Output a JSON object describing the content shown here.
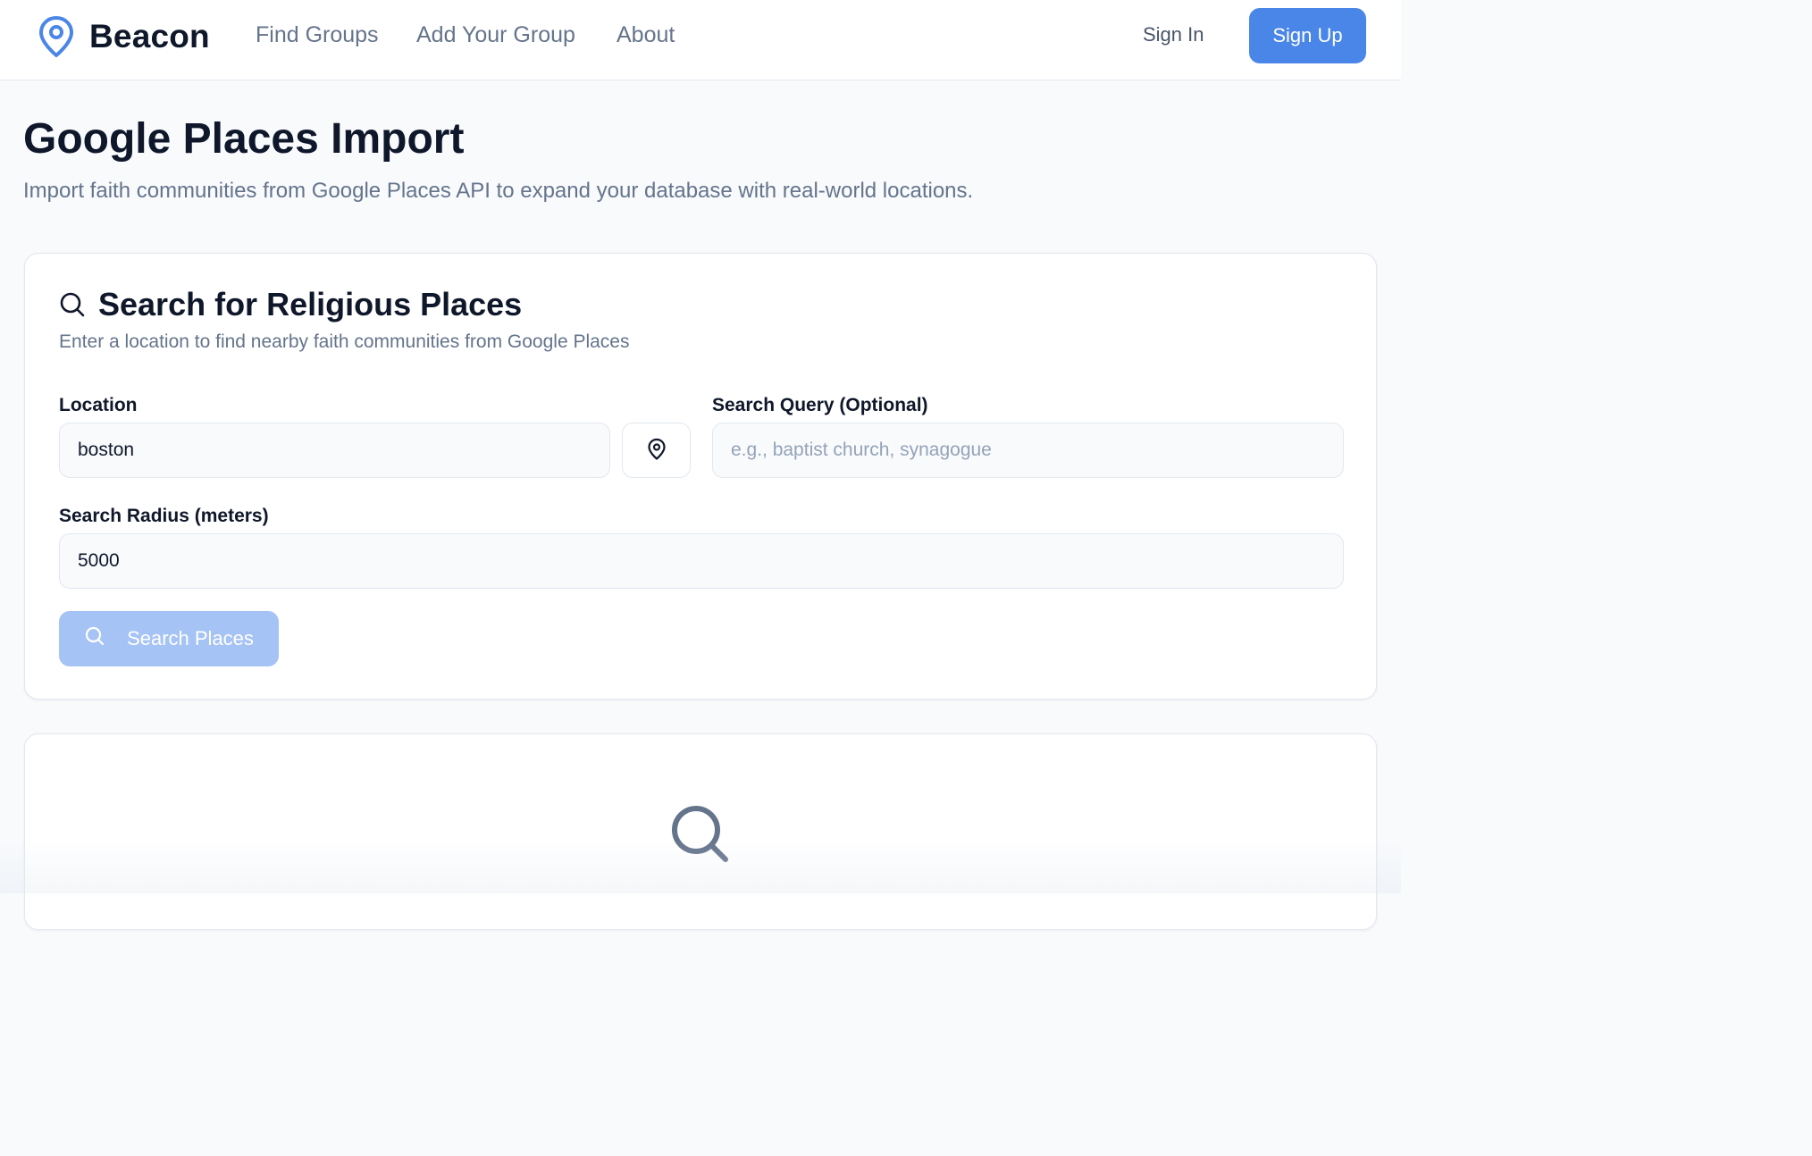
{
  "header": {
    "brand": "Beacon",
    "brand_icon": "map-pin-icon",
    "nav": {
      "find_groups": "Find Groups",
      "add_group": "Add Your Group",
      "about": "About"
    },
    "sign_in": "Sign In",
    "sign_up": "Sign Up"
  },
  "page": {
    "title": "Google Places Import",
    "subtitle": "Import faith communities from Google Places API to expand your database with real-world locations."
  },
  "search_card": {
    "icon": "search-icon",
    "title": "Search for Religious Places",
    "description": "Enter a location to find nearby faith communities from Google Places",
    "location": {
      "label": "Location",
      "value": "boston",
      "locate_icon": "map-pin-icon"
    },
    "query": {
      "label": "Search Query (Optional)",
      "value": "",
      "placeholder": "e.g., baptist church, synagogue"
    },
    "radius": {
      "label": "Search Radius (meters)",
      "value": "5000"
    },
    "search_button": {
      "label": "Search Places",
      "icon": "search-icon",
      "disabled": true
    }
  },
  "results_card": {
    "icon": "search-icon"
  },
  "colors": {
    "accent": "#4a86e8",
    "accent_disabled": "#a6c3f5",
    "text": "#0f172a",
    "muted": "#64748b",
    "border": "#e2e8f0",
    "background": "#f8fafc"
  }
}
